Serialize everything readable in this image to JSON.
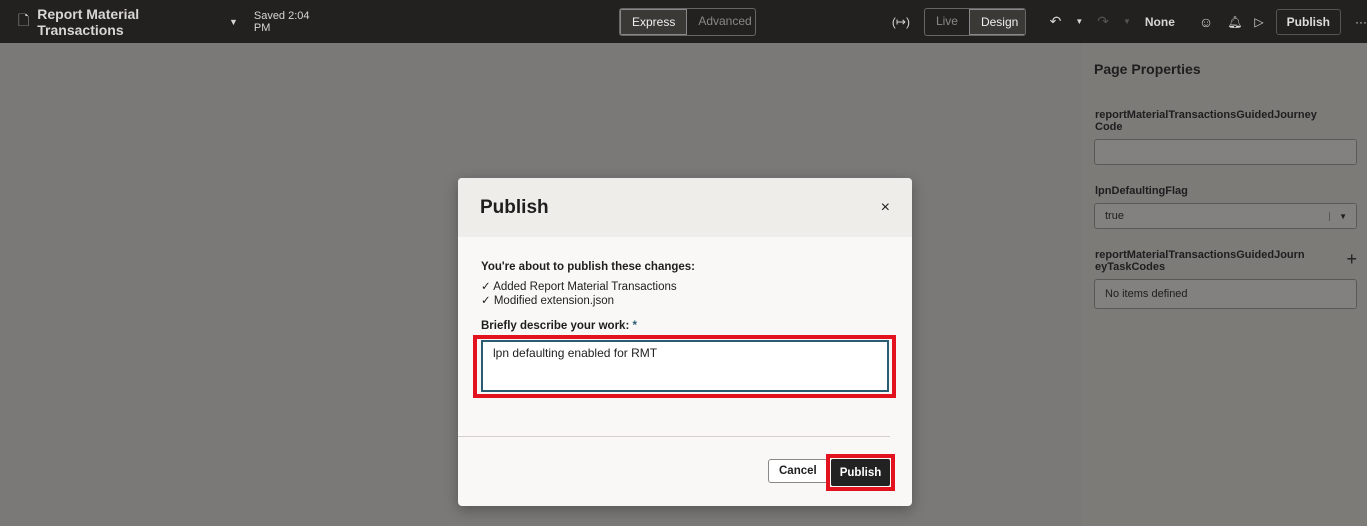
{
  "header": {
    "title": "Report Material Transactions",
    "saved": "Saved 2:04 PM",
    "modes": [
      "Express",
      "Advanced"
    ],
    "views": [
      "Live",
      "Design"
    ],
    "var_icon": "(↦)",
    "none": "None",
    "publish": "Publish"
  },
  "sidebar": {
    "title": "Page Properties",
    "fields": [
      {
        "label": "reportMaterialTransactionsGuidedJourney Code",
        "value": ""
      },
      {
        "label": "lpnDefaultingFlag",
        "value": "true"
      },
      {
        "label": "reportMaterialTransactionsGuidedJourneyTaskCodes",
        "value": "No items defined"
      }
    ]
  },
  "dialog": {
    "title": "Publish",
    "intro": "You're about to publish these changes:",
    "changes": [
      "Added Report Material Transactions",
      "Modified extension.json"
    ],
    "desc_label": "Briefly describe your work:",
    "required": "*",
    "desc_value": "lpn defaulting enabled for RMT",
    "cancel": "Cancel",
    "publish": "Publish"
  }
}
